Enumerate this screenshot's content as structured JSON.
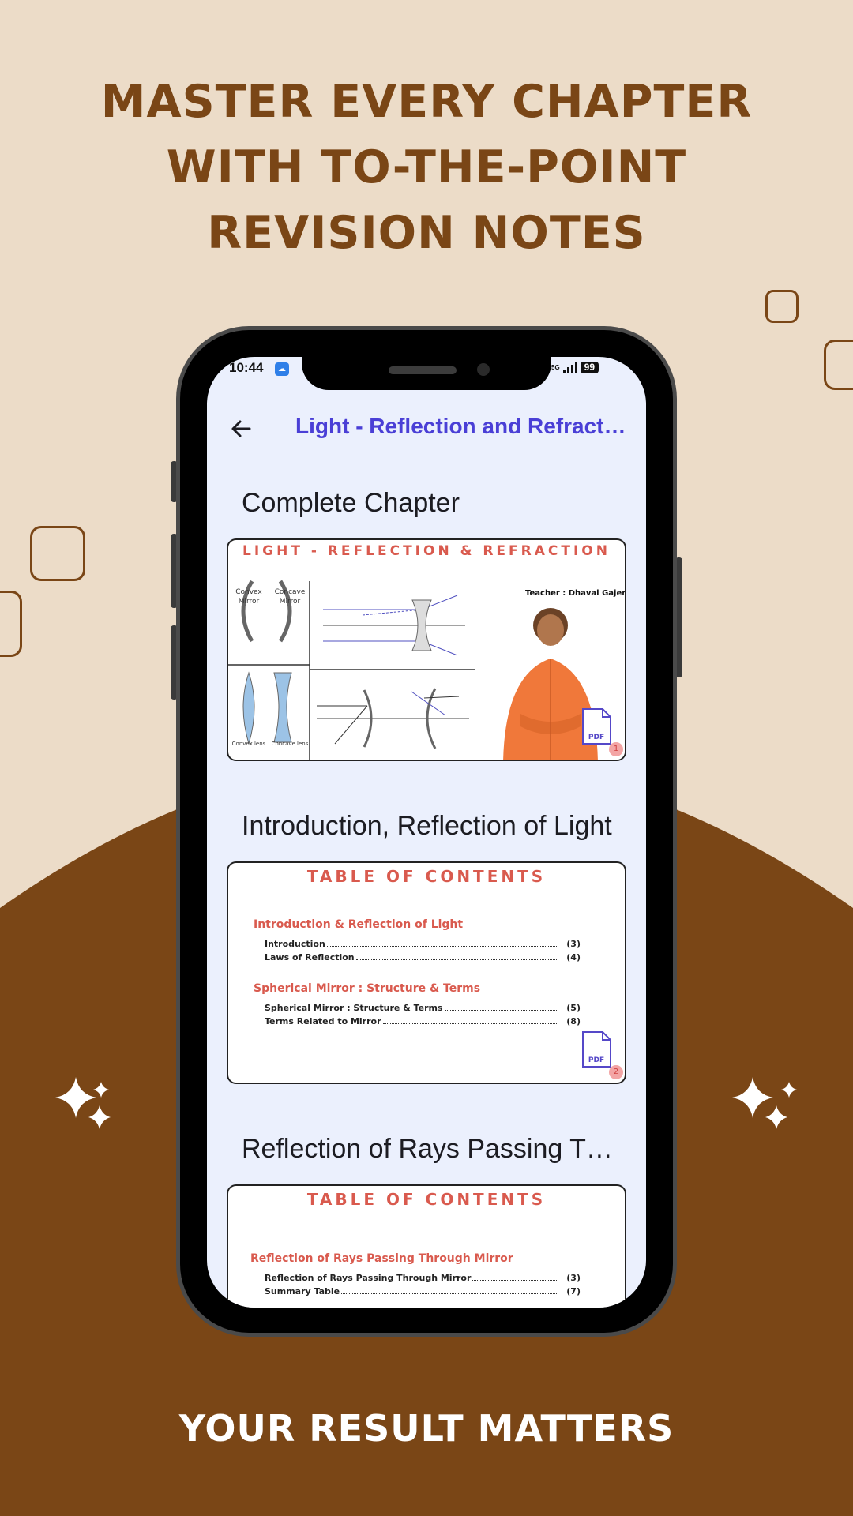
{
  "promo": {
    "title_lines": [
      "MASTER EVERY CHAPTER",
      "WITH TO-THE-POINT",
      "REVISION NOTES"
    ],
    "footer": "YOUR RESULT MATTERS",
    "colors": {
      "background": "#ecdcc8",
      "brown": "#7a4616",
      "accent_text": "#7a4616"
    }
  },
  "status_bar": {
    "time": "10:44",
    "network": "5G",
    "battery": "99"
  },
  "app_bar": {
    "back_icon": "arrow-left-icon",
    "title": "Light - Reflection and Refraction"
  },
  "sections": [
    {
      "title": "Complete Chapter",
      "card": {
        "heading": "LIGHT - REFLECTION & REFRACTION",
        "teacher": "Teacher : Dhaval Gajera",
        "labels": [
          "Convex Mirror",
          "Concave Mirror",
          "Convex lens",
          "Concave lens"
        ],
        "pdf_label": "PDF",
        "page_badge": "1"
      }
    },
    {
      "title": "Introduction, Reflection of Light",
      "card": {
        "heading": "TABLE OF CONTENTS",
        "groups": [
          {
            "title": "Introduction & Reflection of Light",
            "entries": [
              {
                "label": "Introduction",
                "page": "(3)"
              },
              {
                "label": "Laws of Reflection",
                "page": "(4)"
              }
            ]
          },
          {
            "title": "Spherical Mirror : Structure & Terms",
            "entries": [
              {
                "label": "Spherical Mirror : Structure & Terms",
                "page": "(5)"
              },
              {
                "label": "Terms Related to Mirror",
                "page": "(8)"
              }
            ]
          }
        ],
        "pdf_label": "PDF",
        "page_badge": "2"
      }
    },
    {
      "title": "Reflection of Rays Passing Through Mirror",
      "card": {
        "heading": "TABLE OF CONTENTS",
        "groups": [
          {
            "title": "Reflection of Rays Passing Through Mirror",
            "entries": [
              {
                "label": "Reflection of Rays Passing Through Mirror",
                "page": "(3)"
              },
              {
                "label": "Summary Table",
                "page": "(7)"
              }
            ]
          }
        ]
      }
    }
  ]
}
